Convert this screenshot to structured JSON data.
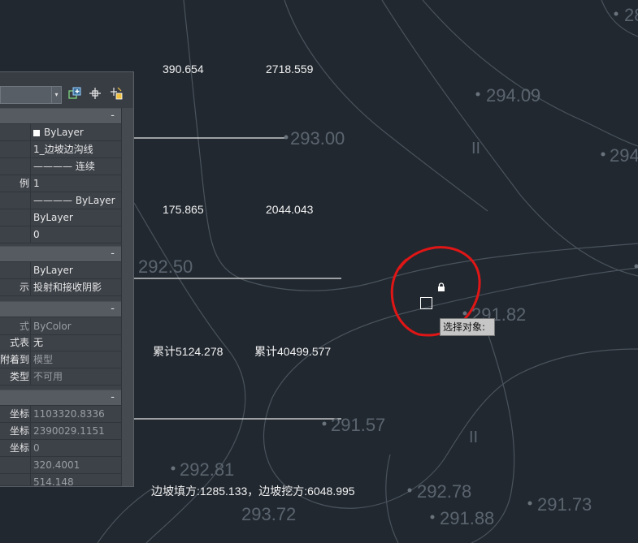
{
  "table_values": [
    {
      "id": "v1",
      "text": "390.654"
    },
    {
      "id": "v2",
      "text": "2718.559"
    },
    {
      "id": "v3",
      "text": "175.865"
    },
    {
      "id": "v4",
      "text": "2044.043"
    },
    {
      "id": "v5",
      "text": "累计5124.278"
    },
    {
      "id": "v6",
      "text": "累计40499.577"
    },
    {
      "id": "v7",
      "text": "边坡填方:1285.133，边坡挖方:6048.995"
    }
  ],
  "elevations": [
    {
      "id": "e1",
      "text": "294.09"
    },
    {
      "id": "e2",
      "text": "293.00"
    },
    {
      "id": "e3",
      "text": "294"
    },
    {
      "id": "e4",
      "text": "292.50"
    },
    {
      "id": "e5",
      "text": "291.82"
    },
    {
      "id": "e6",
      "text": "291.57"
    },
    {
      "id": "e7",
      "text": "292.81"
    },
    {
      "id": "e8",
      "text": "293.72"
    },
    {
      "id": "e9",
      "text": "292.78"
    },
    {
      "id": "e10",
      "text": "291.88"
    },
    {
      "id": "e11",
      "text": "291.73"
    },
    {
      "id": "e12",
      "text": "28"
    }
  ],
  "ticks": [
    "II",
    "II"
  ],
  "palette": {
    "sections": [
      {
        "rows": [
          {
            "key": "",
            "value": "ByLayer",
            "swatch": true
          },
          {
            "key": "",
            "value": "1_边坡边沟线"
          },
          {
            "key": "",
            "value": "———— 连续"
          },
          {
            "key": "例",
            "value": "1"
          },
          {
            "key": "",
            "value": "———— ByLayer"
          },
          {
            "key": "",
            "value": "ByLayer"
          },
          {
            "key": "",
            "value": "0"
          }
        ]
      },
      {
        "rows": [
          {
            "key": "",
            "value": "ByLayer"
          },
          {
            "key": "示",
            "value": "投射和接收阴影"
          }
        ]
      },
      {
        "rows": [
          {
            "key": "式",
            "value": "ByColor",
            "dim": true
          },
          {
            "key": "式表",
            "value": "无"
          },
          {
            "key": "附着到",
            "value": "模型",
            "dim": true
          },
          {
            "key": "类型",
            "value": "不可用",
            "dim": true
          }
        ]
      },
      {
        "rows": [
          {
            "key": "坐标",
            "value": "1103320.8336",
            "dim": true
          },
          {
            "key": "坐标",
            "value": "2390029.1151",
            "dim": true
          },
          {
            "key": "坐标",
            "value": "0",
            "dim": true
          },
          {
            "key": "",
            "value": "320.4001",
            "dim": true
          },
          {
            "key": "",
            "value": "514.148",
            "dim": true
          }
        ]
      }
    ],
    "section_toggle": "-",
    "combo_arrow": "▾"
  },
  "tooltip": "选择对象:",
  "icons": {
    "quick_select": "quick-select-icon",
    "select_objects": "select-objects-icon",
    "pickadd": "pickadd-toggle-icon",
    "lock": "lock-icon"
  },
  "colors": {
    "background": "#212830",
    "annotation_circle": "#e01616",
    "contour": "#4a525b"
  }
}
